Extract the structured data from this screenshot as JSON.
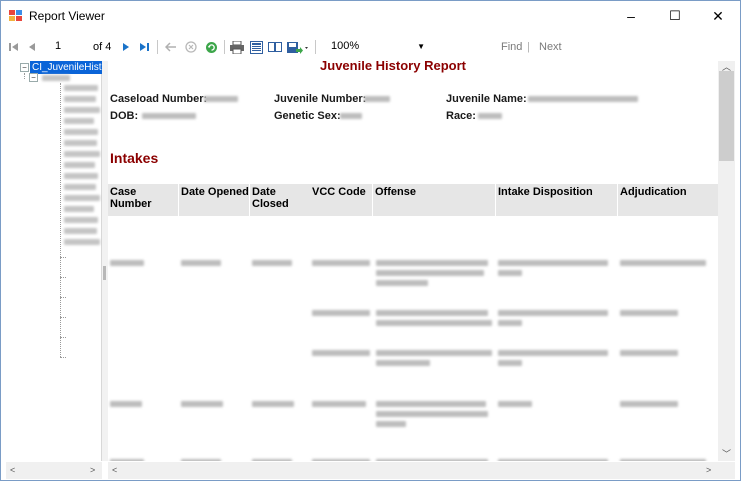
{
  "window": {
    "title": "Report Viewer",
    "minimize": "–",
    "maximize": "☐",
    "close": "✕"
  },
  "toolbar": {
    "page_current": "1",
    "page_of": "of 4",
    "zoom": "100%",
    "find": "Find",
    "separator": "|",
    "next": "Next"
  },
  "docmap": {
    "root_label": "CI_JuvenileHistory"
  },
  "report": {
    "title": "Juvenile History Report",
    "caseload_label": "Caseload Number:",
    "juvenile_number_label": "Juvenile Number:",
    "juvenile_name_label": "Juvenile Name:",
    "dob_label": "DOB:",
    "genetic_sex_label": "Genetic Sex:",
    "race_label": "Race:",
    "section_title": "Intakes",
    "columns": [
      "Case Number",
      "Date Opened",
      "Date Closed",
      "VCC Code",
      "Offense",
      "Intake Disposition",
      "Adjudication"
    ]
  },
  "colors": {
    "accent": "#8b0000",
    "selection": "#0a64d8",
    "header_bg": "#e6e6e6"
  }
}
